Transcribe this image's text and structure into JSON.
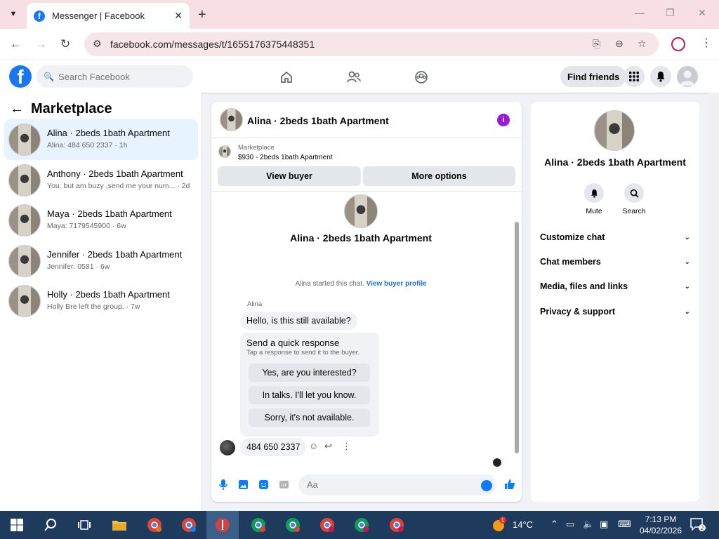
{
  "browser": {
    "tab_title": "Messenger | Facebook",
    "url": "facebook.com/messages/t/1655176375448351"
  },
  "fb_header": {
    "search_placeholder": "Search Facebook",
    "find_friends": "Find friends"
  },
  "left_pane": {
    "title": "Marketplace",
    "conversations": [
      {
        "name": "Alina · 2beds 1bath Apartment",
        "snippet": "Alina: 484 650 2337 · 1h",
        "active": true
      },
      {
        "name": "Anthony · 2beds 1bath Apartment",
        "snippet": "You: but am buzy ,send me your num... · 2d",
        "active": false
      },
      {
        "name": "Maya · 2beds 1bath Apartment",
        "snippet": "Maya: 7179545900 · 6w",
        "active": false
      },
      {
        "name": "Jennifer · 2beds 1bath Apartment",
        "snippet": "Jennifer: 0581 · 6w",
        "active": false
      },
      {
        "name": "Holly · 2beds 1bath Apartment",
        "snippet": "Holly Bre left the group. · 7w",
        "active": false
      }
    ]
  },
  "chat": {
    "header_name": "Alina · 2beds 1bath Apartment",
    "marketplace_label": "Marketplace",
    "listing": "$930 - 2beds 1bath Apartment",
    "view_buyer": "View buyer",
    "more_options": "More options",
    "profile_name": "Alina · 2beds 1bath Apartment",
    "started_text": "Alina started this chat.",
    "view_buyer_profile": "View buyer profile",
    "sender_name": "Alina",
    "first_message": "Hello, is this still available?",
    "quick_response_title": "Send a quick response",
    "quick_response_sub": "Tap a response to send it to the buyer.",
    "quick_responses": [
      "Yes, are you interested?",
      "In talks. I'll let you know.",
      "Sorry, it's not available."
    ],
    "last_message": "484 650 2337",
    "composer_placeholder": "Aa"
  },
  "right_pane": {
    "name": "Alina · 2beds 1bath Apartment",
    "mute": "Mute",
    "search": "Search",
    "sections": [
      "Customize chat",
      "Chat members",
      "Media, files and links",
      "Privacy & support"
    ]
  },
  "taskbar": {
    "temperature": "14°C",
    "time": "7:13 PM",
    "date": "04/02/2026",
    "notification_count": "2",
    "weather_badge": "1"
  },
  "colors": {
    "fb_blue": "#1877f2",
    "messenger_blue": "#0a7cff",
    "active_row": "#e7f3ff",
    "info_purple": "#9c1ad6"
  }
}
